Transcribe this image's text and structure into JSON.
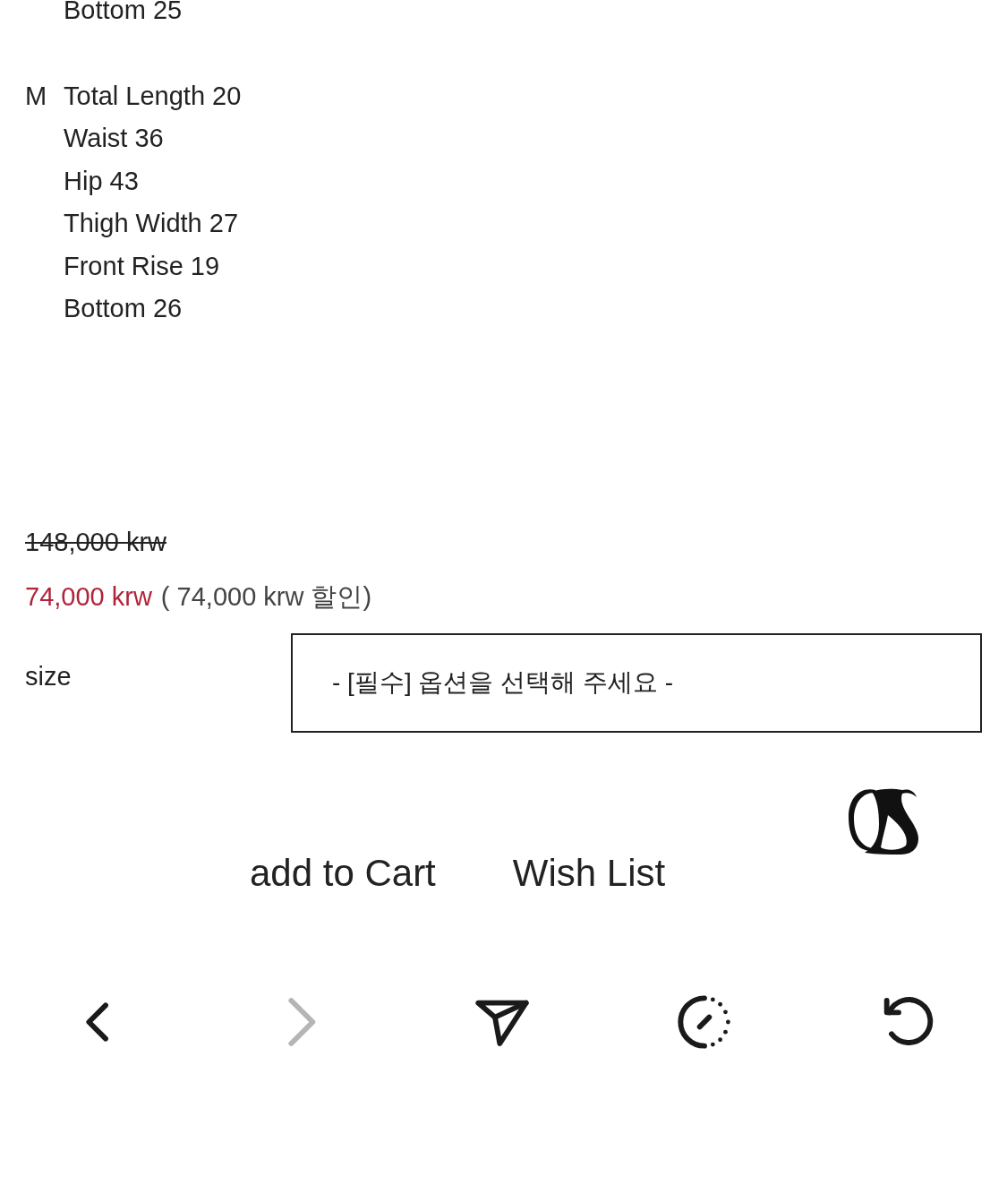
{
  "size_groups": [
    {
      "measurements": [
        "Bottom 25"
      ]
    },
    {
      "size": "M",
      "measurements": [
        "Total Length 20",
        "Waist 36",
        "Hip 43",
        "Thigh Width 27",
        "Front Rise 19",
        "Bottom 26"
      ]
    }
  ],
  "price": {
    "original": "148,000 krw",
    "sale": "74,000 krw",
    "discount": "( 74,000 krw 할인)"
  },
  "option": {
    "label": "size",
    "value": "- [필수] 옵션을 선택해 주세요 -"
  },
  "actions": [
    "add to Cart",
    "Wish List"
  ],
  "toolbar": [
    {
      "kind": "back",
      "disabled": false
    },
    {
      "kind": "forward",
      "disabled": true
    },
    {
      "kind": "share",
      "disabled": false
    },
    {
      "kind": "timer",
      "disabled": false
    },
    {
      "kind": "reload",
      "disabled": false
    }
  ]
}
